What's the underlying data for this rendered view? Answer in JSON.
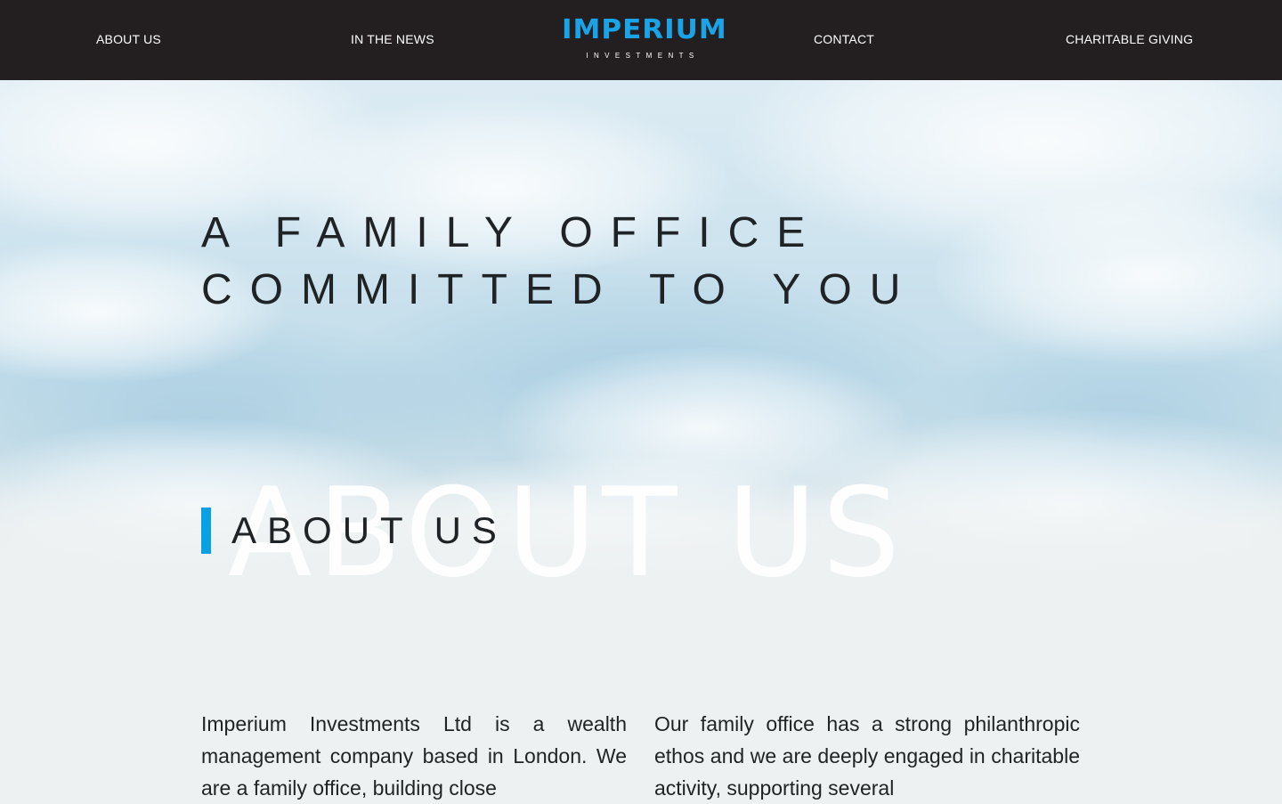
{
  "nav": {
    "links": [
      {
        "id": "about",
        "label": "ABOUT US"
      },
      {
        "id": "news",
        "label": "IN THE NEWS"
      },
      {
        "id": "contact",
        "label": "CONTACT"
      },
      {
        "id": "charity",
        "label": "CHARITABLE GIVING"
      }
    ],
    "logo": {
      "name": "IMPERIUM",
      "tagline": "INVESTMENTS",
      "color": "#1aa3e6"
    },
    "background": "#231f20"
  },
  "hero": {
    "title_line1": "A FAMILY OFFICE",
    "title_line2": "COMMITTED TO YOU"
  },
  "about": {
    "watermark": "ABOUT US",
    "heading": "ABOUT US",
    "accent_color": "#0aa0e6",
    "paragraph_left": "Imperium Investments Ltd is a wealth management company based in London. We are a family office, building close",
    "paragraph_right": "Our family office has a strong philanthropic ethos and we are deeply engaged in charitable activity, supporting several"
  }
}
